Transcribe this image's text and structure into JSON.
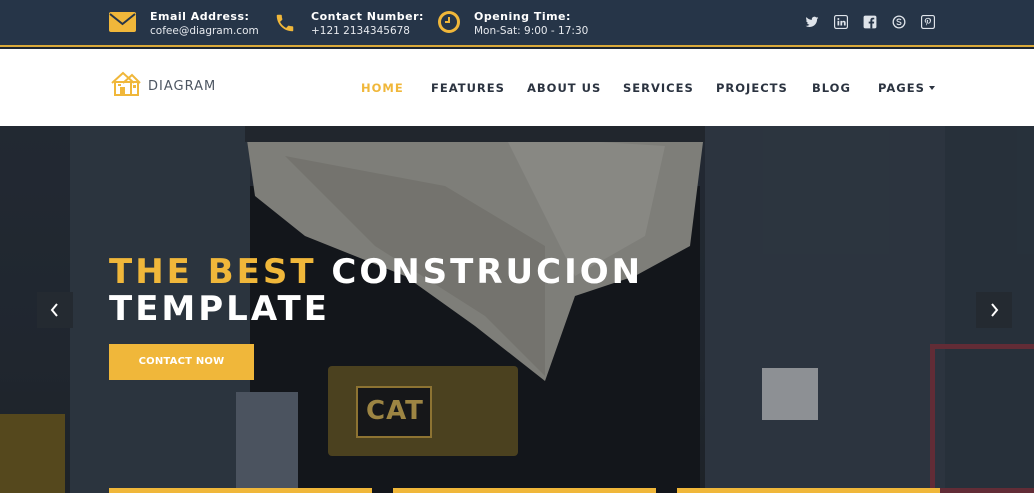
{
  "topbar": {
    "email": {
      "label": "Email Address:",
      "value": "cofee@diagram.com",
      "icon": "envelope-icon"
    },
    "phone": {
      "label": "Contact Number:",
      "value": "+121 2134345678",
      "icon": "phone-icon"
    },
    "hours": {
      "label": "Opening Time:",
      "value": "Mon-Sat: 9:00 - 17:30",
      "icon": "clock-icon"
    },
    "social": [
      "twitter-icon",
      "linkedin-icon",
      "facebook-icon",
      "skype-icon",
      "pinterest-icon"
    ]
  },
  "header": {
    "logo_text": "DIAGRAM",
    "nav": [
      "HOME",
      "FEATURES",
      "ABOUT US",
      "SERVICES",
      "PROJECTS",
      "BLOG",
      "PAGES"
    ],
    "active": "HOME"
  },
  "hero": {
    "title_highlight": "THE BEST",
    "title_rest_line1": "CONSTRUCION",
    "title_line2": "TEMPLATE",
    "cta_label": "CONTACT NOW",
    "image_sign_text": "CAT"
  },
  "colors": {
    "accent": "#f0b73a",
    "topbar_bg": "#263548",
    "nav_text": "#2b3340"
  }
}
